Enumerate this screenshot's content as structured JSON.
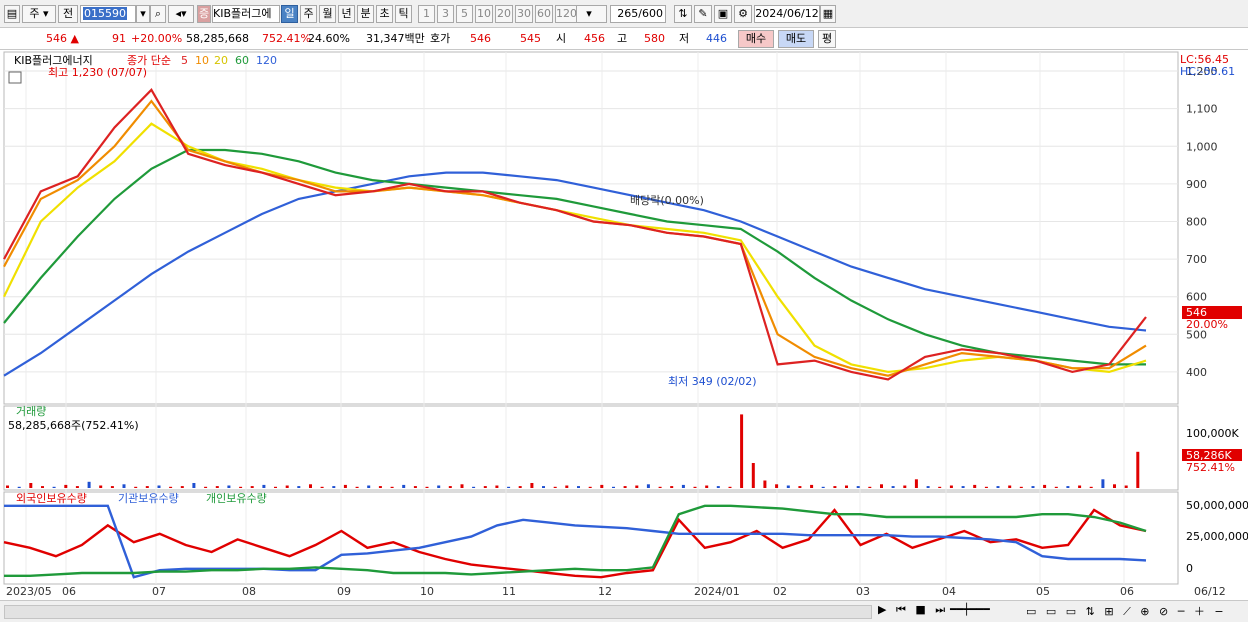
{
  "toolbar": {
    "btn_type": "주",
    "btn_prev": "전",
    "code": "015590",
    "name": "KIB플러그에",
    "periods": [
      "일",
      "주",
      "월",
      "년",
      "분",
      "초",
      "틱"
    ],
    "intervals": [
      "1",
      "3",
      "5",
      "10",
      "20",
      "30",
      "60",
      "120"
    ],
    "count": "265",
    "count_total": "/600",
    "date": "2024/06/12"
  },
  "quote": {
    "price": "546",
    "change": "91",
    "change_pct": "+20.00%",
    "volume": "58,285,668",
    "volume_ratio": "752.41%",
    "turnover": "24.60%",
    "amount": "31,347백만",
    "hoga_label": "호가",
    "ask": "546",
    "bid": "545",
    "open_label": "시",
    "open": "456",
    "high_label": "고",
    "high": "580",
    "low_label": "저",
    "low": "446",
    "buy": "매수",
    "sell": "매도",
    "eval": "평"
  },
  "colors": {
    "up": "#e00000",
    "down": "#1e4fd0",
    "ma5": "#dd2222",
    "ma10": "#f08c00",
    "ma20": "#f0e000",
    "ma60": "#1f9a3a",
    "ma120": "#3060d8"
  },
  "chart_data": [
    {
      "type": "line",
      "title": "KIB플러그에너지",
      "legend": {
        "close_label": "종가",
        "method": "단순",
        "periods": [
          "5",
          "10",
          "20",
          "60",
          "120"
        ]
      },
      "ylim": [
        320,
        1240
      ],
      "yticks": [
        "1,200",
        "1,100",
        "1,000",
        "900",
        "800",
        "700",
        "600",
        "500",
        "400"
      ],
      "x": [
        "2023/05",
        "06",
        "07",
        "08",
        "09",
        "10",
        "11",
        "12",
        "2024/01",
        "02",
        "03",
        "04",
        "05",
        "06",
        "06/12"
      ],
      "series": [
        {
          "name": "5",
          "values": [
            700,
            880,
            920,
            1050,
            1150,
            980,
            950,
            930,
            900,
            870,
            880,
            900,
            880,
            880,
            850,
            830,
            800,
            790,
            770,
            760,
            740,
            420,
            430,
            400,
            380,
            440,
            460,
            450,
            430,
            400,
            420,
            546
          ]
        },
        {
          "name": "10",
          "values": [
            680,
            860,
            910,
            1000,
            1120,
            990,
            960,
            930,
            910,
            880,
            880,
            890,
            880,
            870,
            850,
            830,
            800,
            790,
            770,
            760,
            740,
            500,
            440,
            410,
            390,
            420,
            450,
            440,
            430,
            410,
            410,
            470
          ]
        },
        {
          "name": "20",
          "values": [
            600,
            800,
            890,
            960,
            1060,
            1000,
            960,
            940,
            910,
            890,
            880,
            890,
            880,
            870,
            850,
            830,
            810,
            790,
            780,
            770,
            750,
            600,
            470,
            420,
            400,
            410,
            430,
            440,
            430,
            410,
            400,
            430
          ]
        },
        {
          "name": "60",
          "values": [
            530,
            650,
            760,
            860,
            940,
            990,
            990,
            980,
            960,
            930,
            910,
            900,
            890,
            880,
            870,
            860,
            840,
            820,
            800,
            790,
            780,
            720,
            650,
            590,
            540,
            500,
            470,
            450,
            440,
            430,
            420,
            420
          ]
        },
        {
          "name": "120",
          "values": [
            390,
            450,
            520,
            590,
            660,
            720,
            770,
            820,
            860,
            880,
            900,
            920,
            930,
            930,
            920,
            910,
            890,
            870,
            850,
            830,
            800,
            760,
            720,
            680,
            650,
            620,
            600,
            580,
            560,
            540,
            520,
            510
          ]
        }
      ],
      "annotations": {
        "high": "최고 1,230 (07/07)",
        "low": "최저 349 (02/02)",
        "ex_dividend": "배당락(0.00%)",
        "last": "546",
        "last_pct": "20.00%",
        "lc": "LC:56.45",
        "hc": "HC:-55.61"
      }
    },
    {
      "type": "bar",
      "title": "거래량",
      "value_label": "58,285,668주(752.41%)",
      "yticks": [
        "100,000K"
      ],
      "last": "58,286K",
      "last_pct": "752.41%",
      "values_k": [
        4,
        2,
        8,
        3,
        2,
        5,
        3,
        10,
        4,
        3,
        6,
        2,
        3,
        4,
        2,
        3,
        8,
        2,
        3,
        4,
        2,
        3,
        5,
        2,
        4,
        3,
        6,
        2,
        3,
        5,
        2,
        4,
        3,
        2,
        5,
        3,
        2,
        4,
        3,
        6,
        2,
        3,
        4,
        2,
        3,
        8,
        3,
        2,
        4,
        3,
        2,
        5,
        2,
        3,
        4,
        6,
        2,
        3,
        5,
        2,
        4,
        3,
        2,
        118,
        40,
        12,
        6,
        4,
        3,
        5,
        2,
        3,
        4,
        3,
        2,
        6,
        3,
        4,
        14,
        3,
        2,
        4,
        3,
        5,
        2,
        3,
        4,
        2,
        3,
        5,
        2,
        3,
        4,
        2,
        14,
        6,
        4,
        58
      ]
    },
    {
      "type": "line",
      "title": "외국인보유수량",
      "legend": [
        "외국인보유수량",
        "기관보유수량",
        "개인보유수량"
      ],
      "yticks": [
        "50,000,000",
        "25,000,000",
        "0"
      ],
      "ylim": [
        -5000000,
        55000000
      ],
      "series": [
        {
          "name": "외국인보유수량",
          "values": [
            22000000,
            18000000,
            12000000,
            20000000,
            34000000,
            22000000,
            28000000,
            20000000,
            15000000,
            24000000,
            18000000,
            12000000,
            20000000,
            30000000,
            18000000,
            22000000,
            15000000,
            10000000,
            6000000,
            4000000,
            2000000,
            0,
            -2000000,
            -3000000,
            0,
            2000000,
            38000000,
            18000000,
            22000000,
            30000000,
            18000000,
            24000000,
            45000000,
            20000000,
            28000000,
            18000000,
            24000000,
            30000000,
            22000000,
            24000000,
            18000000,
            20000000,
            45000000,
            34000000,
            30000000
          ]
        },
        {
          "name": "기관보유수량",
          "values": [
            48000000,
            48000000,
            48000000,
            48000000,
            48000000,
            -3000000,
            2000000,
            3000000,
            3000000,
            3000000,
            3000000,
            2000000,
            2000000,
            13000000,
            14000000,
            16000000,
            18000000,
            22000000,
            26000000,
            34000000,
            38000000,
            36000000,
            34000000,
            33000000,
            32000000,
            30000000,
            28000000,
            28000000,
            28000000,
            28000000,
            28000000,
            27000000,
            27000000,
            27000000,
            27000000,
            26000000,
            26000000,
            25000000,
            24000000,
            22000000,
            12000000,
            10000000,
            10000000,
            10000000,
            9000000
          ]
        },
        {
          "name": "개인보유수량",
          "values": [
            -2000000,
            -2000000,
            -1000000,
            0,
            0,
            0,
            1000000,
            1000000,
            2000000,
            2000000,
            3000000,
            3000000,
            4000000,
            3000000,
            2000000,
            0,
            0,
            0,
            -1000000,
            0,
            1000000,
            2000000,
            3000000,
            2000000,
            2000000,
            4000000,
            42000000,
            48000000,
            48000000,
            47000000,
            46000000,
            44000000,
            42000000,
            42000000,
            40000000,
            40000000,
            40000000,
            40000000,
            40000000,
            40000000,
            42000000,
            42000000,
            40000000,
            36000000,
            30000000
          ]
        }
      ]
    }
  ]
}
